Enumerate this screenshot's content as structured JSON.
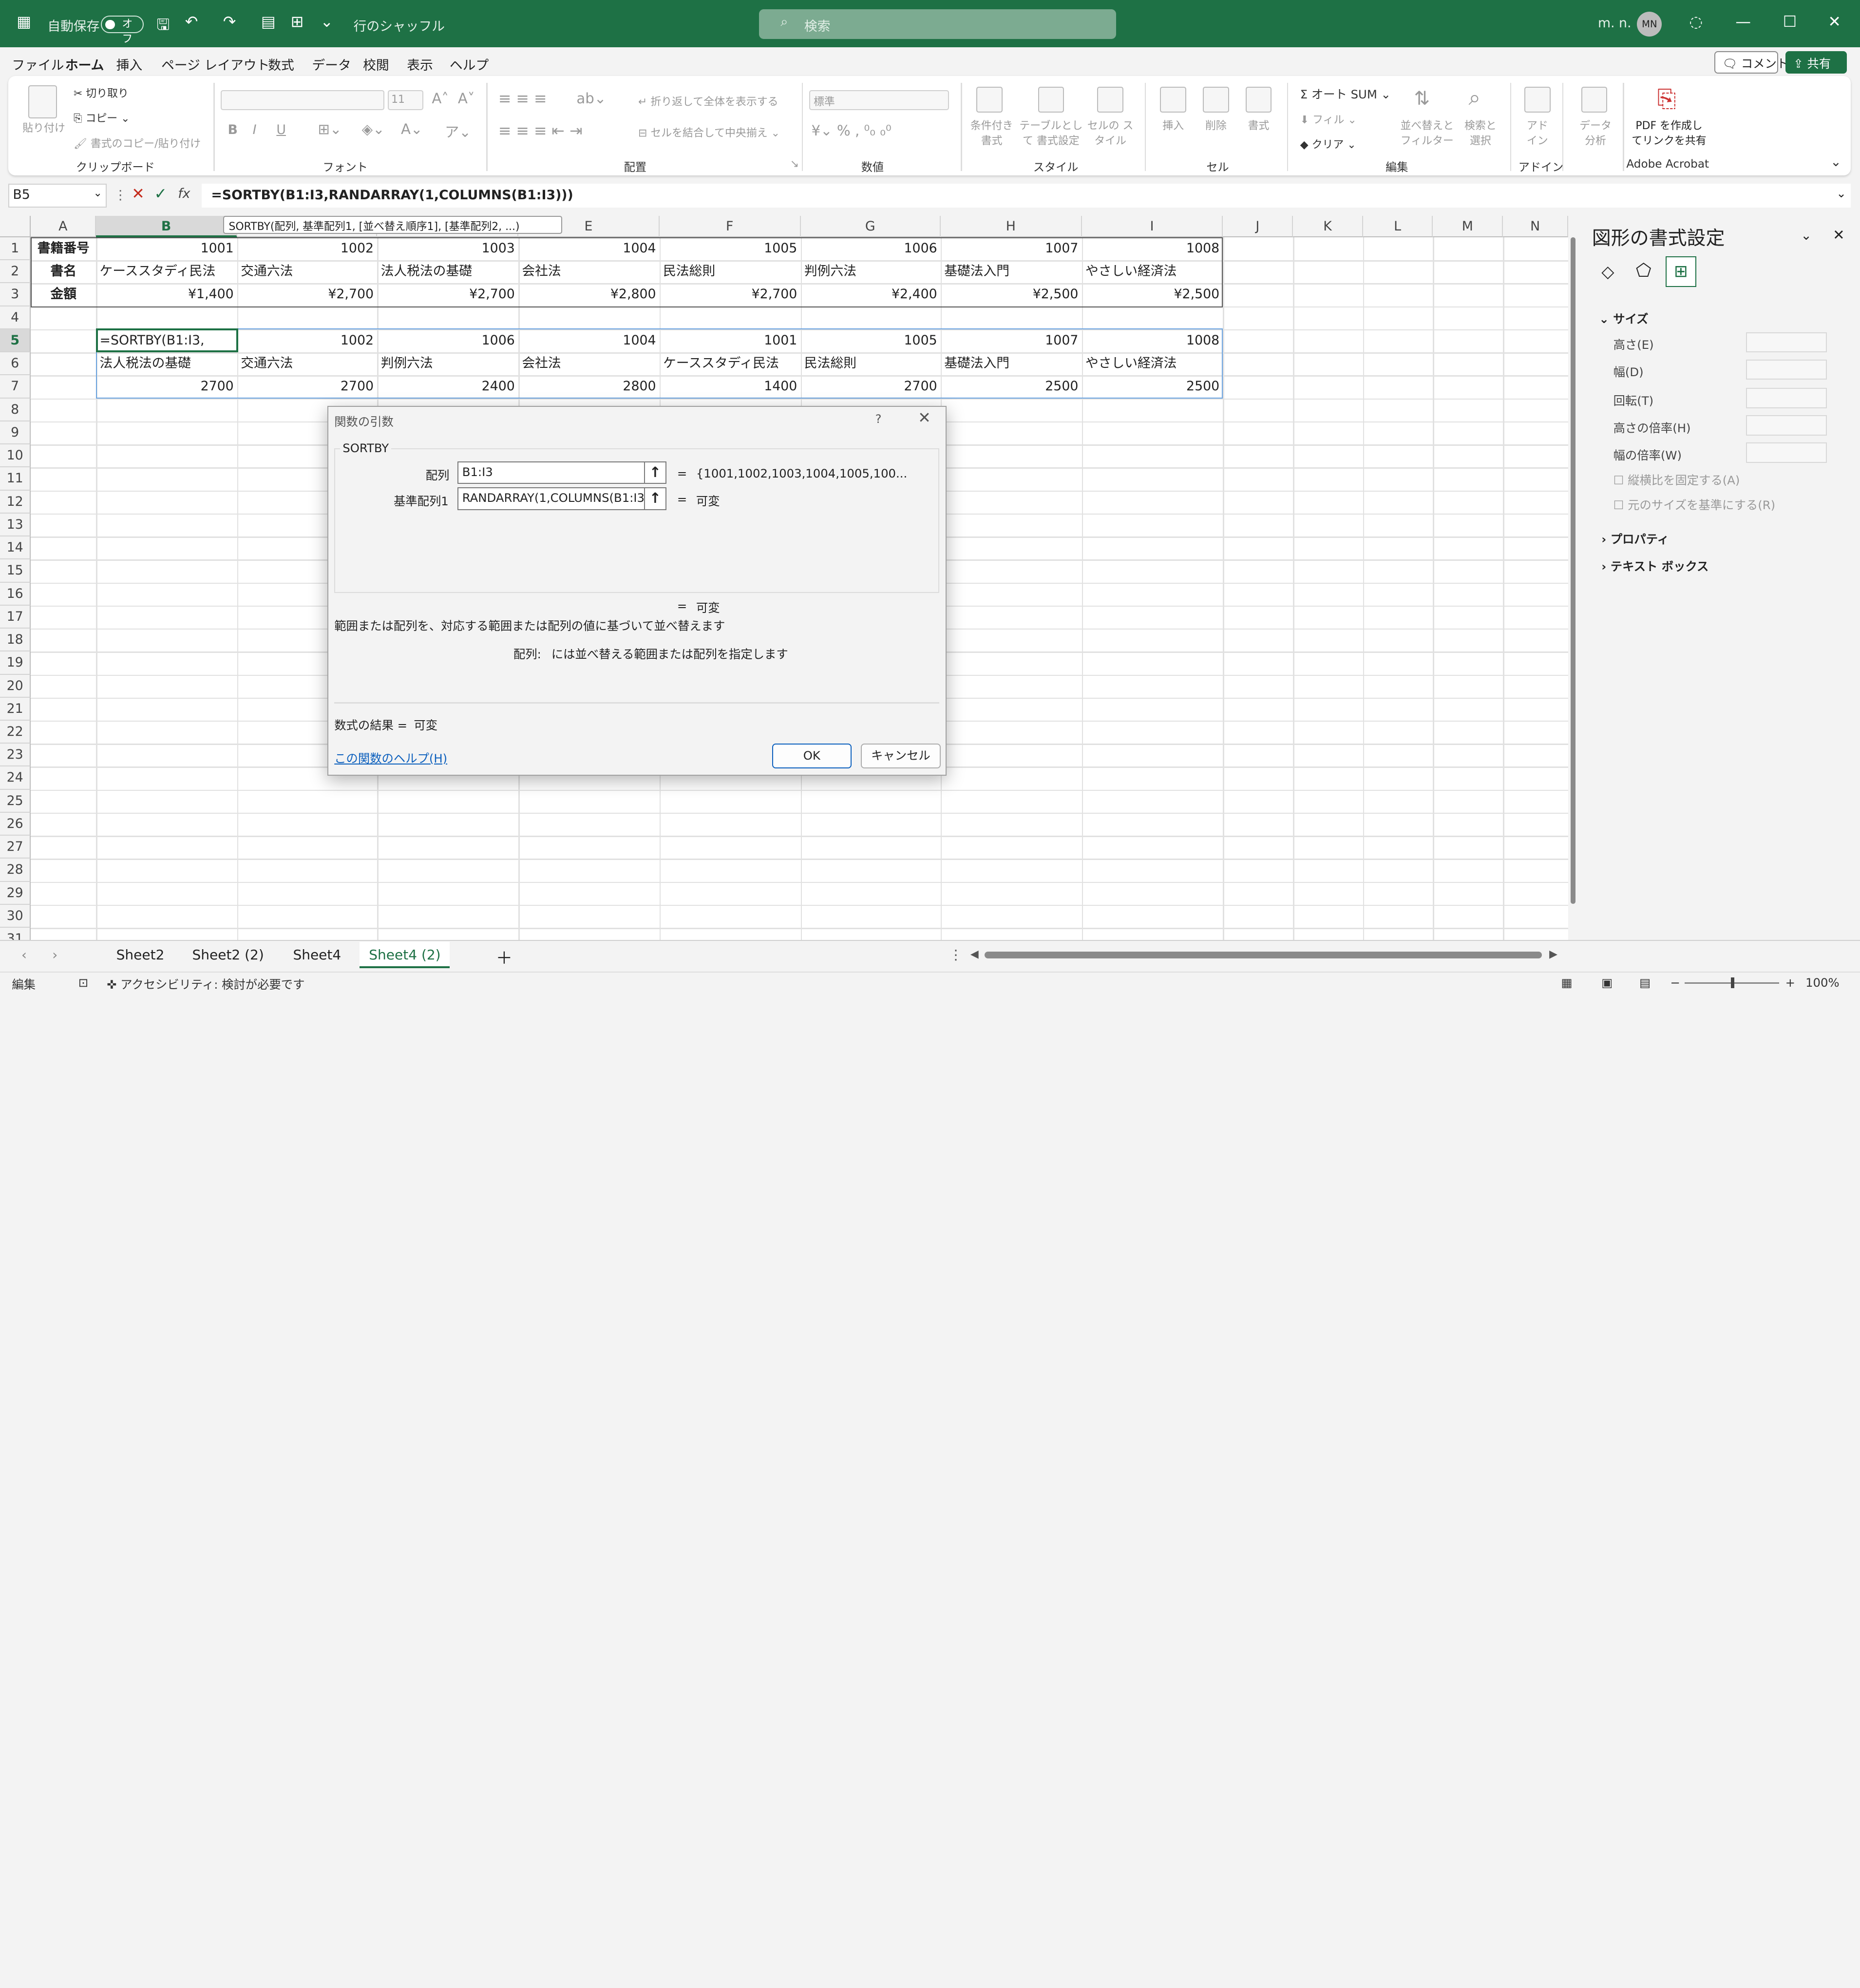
{
  "titlebar": {
    "autosave": "自動保存",
    "autosave_state": "オフ",
    "file_title": "行のシャッフル",
    "search_placeholder": "検索",
    "user": "m. n.",
    "initials": "MN"
  },
  "menu": {
    "items": [
      "ファイル",
      "ホーム",
      "挿入",
      "ページ レイアウト",
      "数式",
      "データ",
      "校閲",
      "表示",
      "ヘルプ"
    ],
    "comment": "コメント",
    "share": "共有"
  },
  "ribbon": {
    "clipboard": {
      "paste": "貼り付け",
      "cut": "切り取り",
      "copy": "コピー",
      "format_painter": "書式のコピー/貼り付け",
      "group": "クリップボード"
    },
    "font": {
      "size": "11",
      "group": "フォント",
      "bold": "B",
      "italic": "I",
      "underline": "U"
    },
    "align": {
      "wrap": "折り返して全体を表示する",
      "merge": "セルを結合して中央揃え",
      "group": "配置"
    },
    "number": {
      "format": "標準",
      "group": "数値"
    },
    "style": {
      "cond": "条件付き 書式",
      "table": "テーブルとして 書式設定",
      "cell": "セルの スタイル",
      "group": "スタイル"
    },
    "cells": {
      "insert": "挿入",
      "delete": "削除",
      "format": "書式",
      "group": "セル"
    },
    "edit": {
      "autosum": "オート SUM",
      "fill": "フィル",
      "clear": "クリア",
      "sort": "並べ替えと フィルター",
      "find": "検索と 選択",
      "group": "編集"
    },
    "addin": {
      "label": "アド イン",
      "group": "アドイン"
    },
    "analysis": {
      "label": "データ 分析"
    },
    "acrobat": {
      "label": "PDF を作成し てリンクを共有",
      "group": "Adobe Acrobat"
    }
  },
  "formula": {
    "namebox": "B5",
    "fx": "fx",
    "content": "=SORTBY(B1:I3,RANDARRAY(1,COLUMNS(B1:I3)))",
    "tooltip": "SORTBY(配列, 基準配列1, [並べ替え順序1], [基準配列2, ...)"
  },
  "columns": [
    "A",
    "B",
    "C",
    "D",
    "E",
    "F",
    "G",
    "H",
    "I",
    "J",
    "K",
    "L",
    "M",
    "N"
  ],
  "rows": [
    "1",
    "2",
    "3",
    "4",
    "5",
    "6",
    "7",
    "8",
    "9",
    "10",
    "11",
    "12",
    "13",
    "14",
    "15",
    "16",
    "17",
    "18",
    "19",
    "20",
    "21",
    "22",
    "23",
    "24",
    "25",
    "26",
    "27",
    "28",
    "29",
    "30",
    "31"
  ],
  "table": {
    "row1": [
      "書籍番号",
      "1001",
      "1002",
      "1003",
      "1004",
      "1005",
      "1006",
      "1007",
      "1008"
    ],
    "row2": [
      "書名",
      "ケーススタディ民法",
      "交通六法",
      "法人税法の基礎",
      "会社法",
      "民法総則",
      "判例六法",
      "基礎法入門",
      "やさしい経済法"
    ],
    "row3": [
      "金額",
      "¥1,400",
      "¥2,700",
      "¥2,700",
      "¥2,800",
      "¥2,700",
      "¥2,400",
      "¥2,500",
      "¥2,500"
    ],
    "row5": [
      "=SORTBY(B1:I3,",
      "1002",
      "1006",
      "1004",
      "1001",
      "1005",
      "1007",
      "1008"
    ],
    "row6": [
      "法人税法の基礎",
      "交通六法",
      "判例六法",
      "会社法",
      "ケーススタディ民法",
      "民法総則",
      "基礎法入門",
      "やさしい経済法"
    ],
    "row7": [
      "2700",
      "2700",
      "2400",
      "2800",
      "1400",
      "2700",
      "2500",
      "2500"
    ]
  },
  "dialog": {
    "title": "関数の引数",
    "help_q": "?",
    "func": "SORTBY",
    "arg1_label": "配列",
    "arg1_value": "B1:I3",
    "arg1_result": "{1001,1002,1003,1004,1005,100...",
    "arg2_label": "基準配列1",
    "arg2_value": "RANDARRAY(1,COLUMNS(B1:I3",
    "arg2_result": "可変",
    "eq": "=",
    "total_result": "可変",
    "description": "範囲または配列を、対応する範囲または配列の値に基づいて並べ替えます",
    "arg_desc_label": "配列:",
    "arg_desc": "には並べ替える範囲または配列を指定します",
    "formula_result_label": "数式の結果 =",
    "formula_result": "可変",
    "help_link": "この関数のヘルプ(H)",
    "ok": "OK",
    "cancel": "キャンセル"
  },
  "pane": {
    "title": "図形の書式設定",
    "section_size": "サイズ",
    "height": "高さ(E)",
    "width": "幅(D)",
    "rotation": "回転(T)",
    "scale_h": "高さの倍率(H)",
    "scale_w": "幅の倍率(W)",
    "lock_aspect": "縦横比を固定する(A)",
    "relative": "元のサイズを基準にする(R)",
    "properties": "プロパティ",
    "textbox": "テキスト ボックス"
  },
  "sheets": [
    "Sheet2",
    "Sheet2 (2)",
    "Sheet4",
    "Sheet4 (2)"
  ],
  "status": {
    "mode": "編集",
    "accessibility": "アクセシビリティ: 検討が必要です",
    "zoom": "100%"
  },
  "colors": {
    "accent": "#1e7145"
  }
}
